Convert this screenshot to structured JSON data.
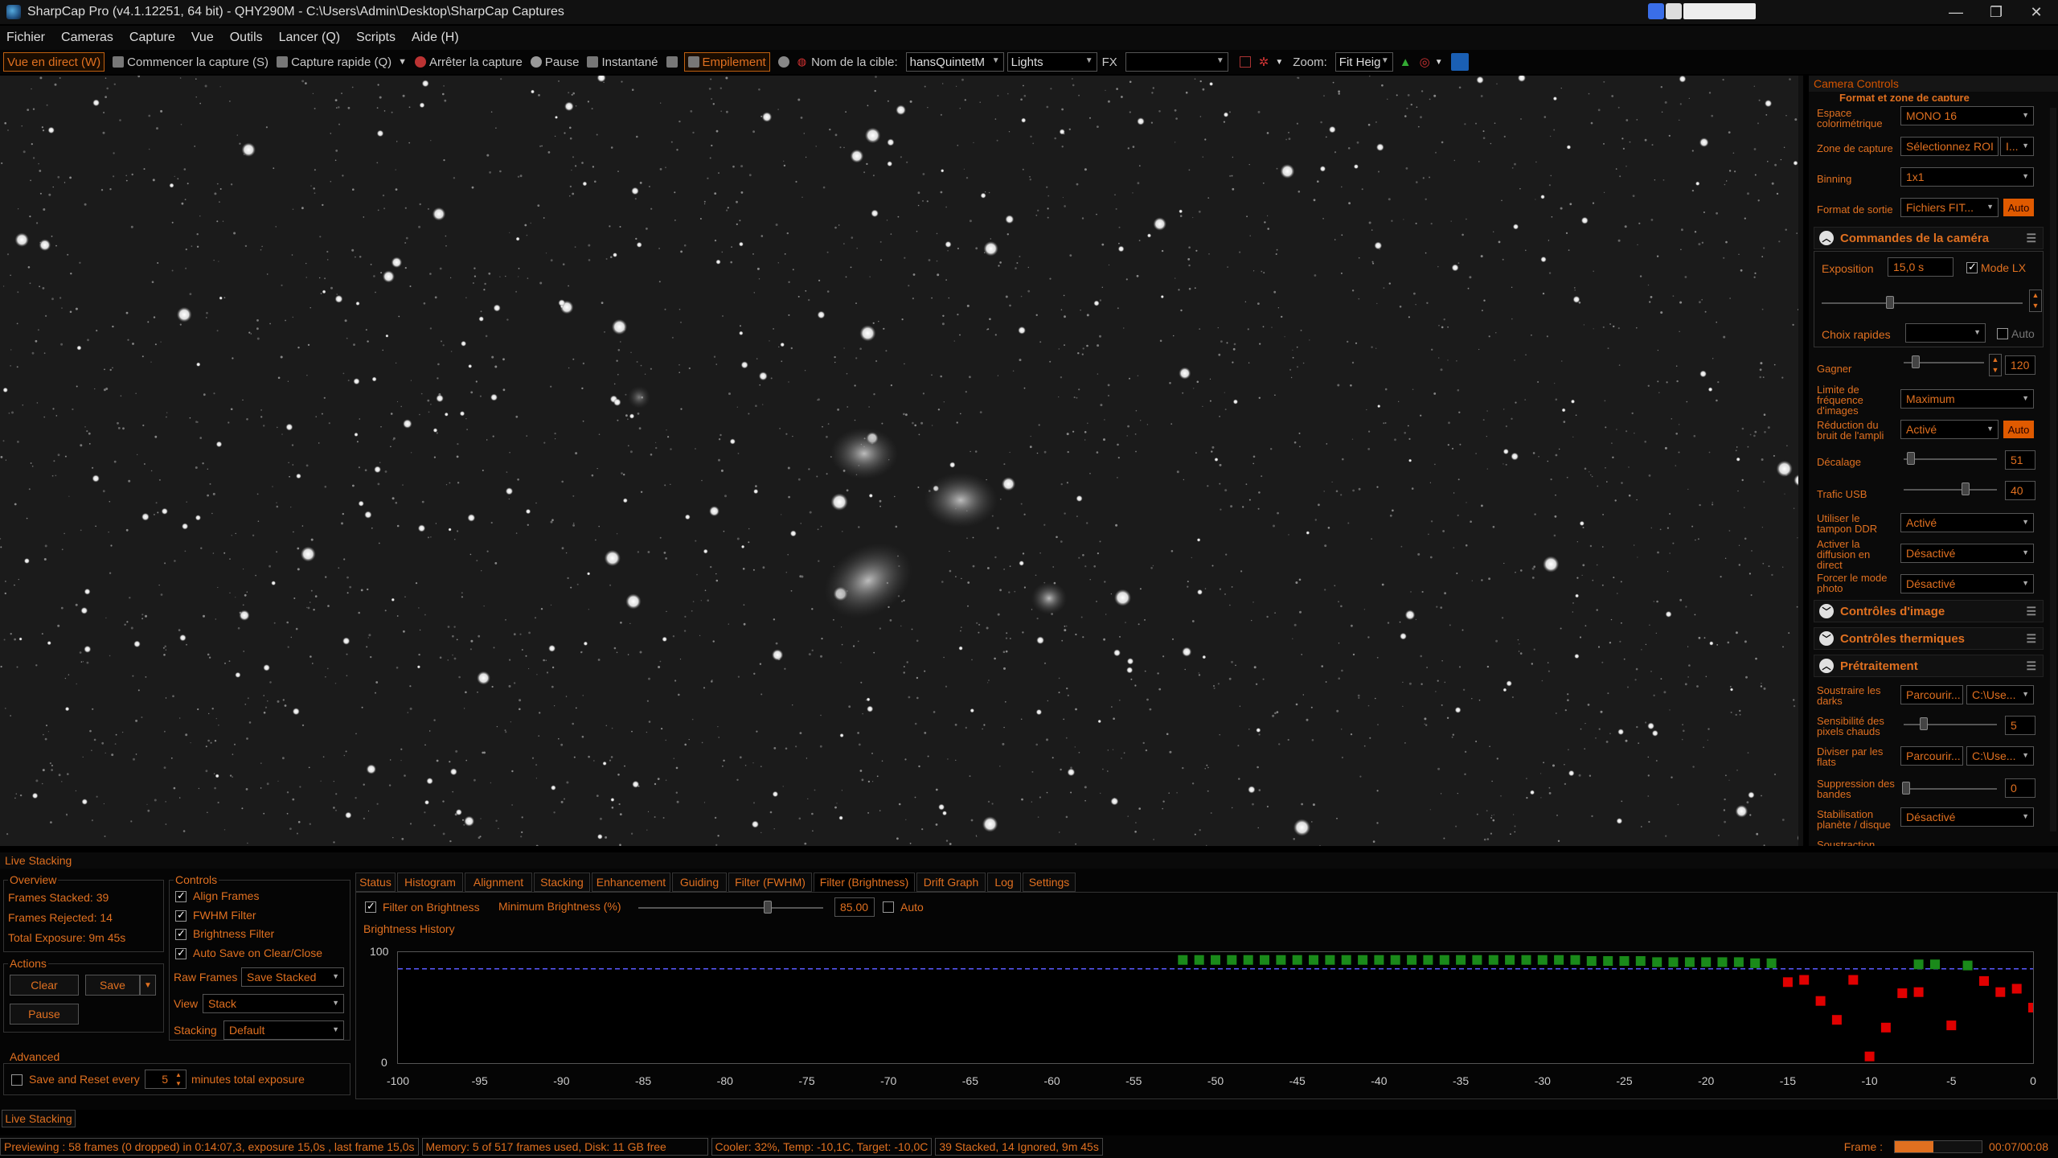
{
  "window": {
    "title": "SharpCap Pro (v4.1.12251, 64 bit) - QHY290M - C:\\Users\\Admin\\Desktop\\SharpCap Captures",
    "controls": [
      "—",
      "❐",
      "✕"
    ]
  },
  "menu": [
    "Fichier",
    "Cameras",
    "Capture",
    "Vue",
    "Outils",
    "Lancer (Q)",
    "Scripts",
    "Aide (H)"
  ],
  "toolbar": {
    "live_view": "Vue en direct (W)",
    "start_capture": "Commencer la capture (S)",
    "quick_capture": "Capture rapide (Q)",
    "stop_capture": "Arrêter la capture",
    "pause": "Pause",
    "snapshot": "Instantané",
    "stacking": "Empilement",
    "target_label": "Nom de la cible:",
    "target_value": "hansQuintetM",
    "frame_type": "Lights",
    "fx_label": "FX",
    "zoom_label": "Zoom:",
    "zoom_value": "Fit Heig"
  },
  "camera_controls": {
    "panel_title": "Camera Controls",
    "cut_section": "Format et zone de capture",
    "colour_space_label": "Espace colorimétrique",
    "colour_space": "MONO 16",
    "capture_area_label": "Zone de capture",
    "capture_area": "Sélectionnez ROI",
    "capture_area_extra": "I...",
    "binning_label": "Binning",
    "binning": "1x1",
    "output_label": "Format de sortie",
    "output": "Fichiers FIT...",
    "auto": "Auto",
    "cam_section": "Commandes de la caméra",
    "exposure_label": "Exposition",
    "exposure": "15,0 s",
    "lx_label": "Mode LX",
    "quick_label": "Choix rapides",
    "gain_label": "Gagner",
    "gain": "120",
    "fps_label": "Limite de fréquence d'images",
    "fps": "Maximum",
    "noise_label": "Réduction du bruit de l'ampli",
    "noise": "Activé",
    "offset_label": "Décalage",
    "offset": "51",
    "usb_label": "Trafic USB",
    "usb": "40",
    "ddr_label": "Utiliser le tampon DDR",
    "ddr": "Activé",
    "stream_label": "Activer la diffusion en direct",
    "stream": "Désactivé",
    "photo_label": "Forcer le mode photo",
    "photo": "Désactivé",
    "image_section": "Contrôles d'image",
    "thermal_section": "Contrôles thermiques",
    "pre_section": "Prétraitement",
    "darks_label": "Soustraire les darks",
    "browse": "Parcourir...",
    "darks_path": "C:\\Use...",
    "hot_label": "Sensibilité des pixels chauds",
    "hot": "5",
    "flats_label": "Diviser par les flats",
    "flats_path": "C:\\Use...",
    "bands_label": "Suppression des bandes",
    "bands": "0",
    "stab_label": "Stabilisation planète / disque",
    "stab": "Désactivé",
    "sub_label": "Soustraction"
  },
  "live_stacking": {
    "title": "Live Stacking",
    "overview_title": "Overview",
    "frames_stacked": "Frames Stacked:  39",
    "frames_rejected": "Frames Rejected:  14",
    "total_exposure": "Total Exposure:   9m 45s",
    "actions_title": "Actions",
    "clear": "Clear",
    "save": "Save",
    "pause": "Pause",
    "advanced_title": "Advanced",
    "save_reset": "Save and Reset every",
    "save_reset_value": "5",
    "save_reset_unit": "minutes total exposure",
    "controls_title": "Controls",
    "align": "Align Frames",
    "fwhm": "FWHM Filter",
    "brightness": "Brightness Filter",
    "autosave": "Auto Save on Clear/Close",
    "raw_label": "Raw Frames",
    "raw_value": "Save Stacked",
    "view_label": "View",
    "view_value": "Stack",
    "stacking_label": "Stacking",
    "stacking_value": "Default",
    "tabs": [
      "Status",
      "Histogram",
      "Alignment",
      "Stacking",
      "Enhancement",
      "Guiding",
      "Filter (FWHM)",
      "Filter (Brightness)",
      "Drift Graph",
      "Log",
      "Settings"
    ],
    "filter_on": "Filter on Brightness",
    "min_brightness_label": "Minimum Brightness (%)",
    "min_brightness": "85.00",
    "auto": "Auto",
    "history_title": "Brightness History",
    "bottom_tab": "Live Stacking"
  },
  "chart_data": {
    "type": "scatter",
    "title": "Brightness History",
    "xlim": [
      -100,
      0
    ],
    "ylim": [
      0,
      100
    ],
    "x_ticks": [
      -100,
      -95,
      -90,
      -85,
      -80,
      -75,
      -70,
      -65,
      -60,
      -55,
      -50,
      -45,
      -40,
      -35,
      -30,
      -25,
      -20,
      -15,
      -10,
      -5,
      0
    ],
    "y_ticks": [
      0,
      100
    ],
    "threshold": 85,
    "accepted_color": "#1a8a1a",
    "rejected_color": "#e00000",
    "series": [
      {
        "points": [
          [
            -52,
            93
          ],
          [
            -51,
            93
          ],
          [
            -50,
            93
          ],
          [
            -49,
            93
          ],
          [
            -48,
            93
          ],
          [
            -47,
            93
          ],
          [
            -46,
            93
          ],
          [
            -45,
            93
          ],
          [
            -44,
            93
          ],
          [
            -43,
            93
          ],
          [
            -42,
            93
          ],
          [
            -41,
            93
          ],
          [
            -40,
            93
          ],
          [
            -39,
            93
          ],
          [
            -38,
            93
          ],
          [
            -37,
            93
          ],
          [
            -36,
            93
          ],
          [
            -35,
            93
          ],
          [
            -34,
            93
          ],
          [
            -33,
            93
          ],
          [
            -32,
            93
          ],
          [
            -31,
            93
          ],
          [
            -30,
            93
          ],
          [
            -29,
            93
          ],
          [
            -28,
            93
          ],
          [
            -27,
            92
          ],
          [
            -26,
            92
          ],
          [
            -25,
            92
          ],
          [
            -24,
            92
          ],
          [
            -23,
            91
          ],
          [
            -22,
            91
          ],
          [
            -21,
            91
          ],
          [
            -20,
            91
          ],
          [
            -19,
            91
          ],
          [
            -18,
            91
          ],
          [
            -17,
            90
          ],
          [
            -16,
            90
          ],
          [
            -7,
            89
          ],
          [
            -6,
            89
          ],
          [
            -4,
            88
          ]
        ]
      },
      {
        "points": [
          [
            -15,
            73
          ],
          [
            -14,
            75
          ],
          [
            -13,
            56
          ],
          [
            -12,
            39
          ],
          [
            -11,
            75
          ],
          [
            -10,
            6
          ],
          [
            -9,
            32
          ],
          [
            -8,
            63
          ],
          [
            -7,
            64
          ],
          [
            -5,
            34
          ],
          [
            -3,
            74
          ],
          [
            -2,
            64
          ],
          [
            -1,
            67
          ],
          [
            0,
            50
          ]
        ]
      }
    ]
  },
  "status": {
    "preview": "Previewing : 58 frames (0 dropped) in 0:14:07,3, exposure 15,0s , last frame 15,0s",
    "memory": "Memory: 5 of 517 frames used, Disk: 11 GB free",
    "cooler": "Cooler: 32%, Temp: -10,1C, Target: -10,0C",
    "stack": "39 Stacked, 14 Ignored, 9m 45s",
    "frame_label": "Frame :",
    "frame_time": "00:07/00:08"
  }
}
